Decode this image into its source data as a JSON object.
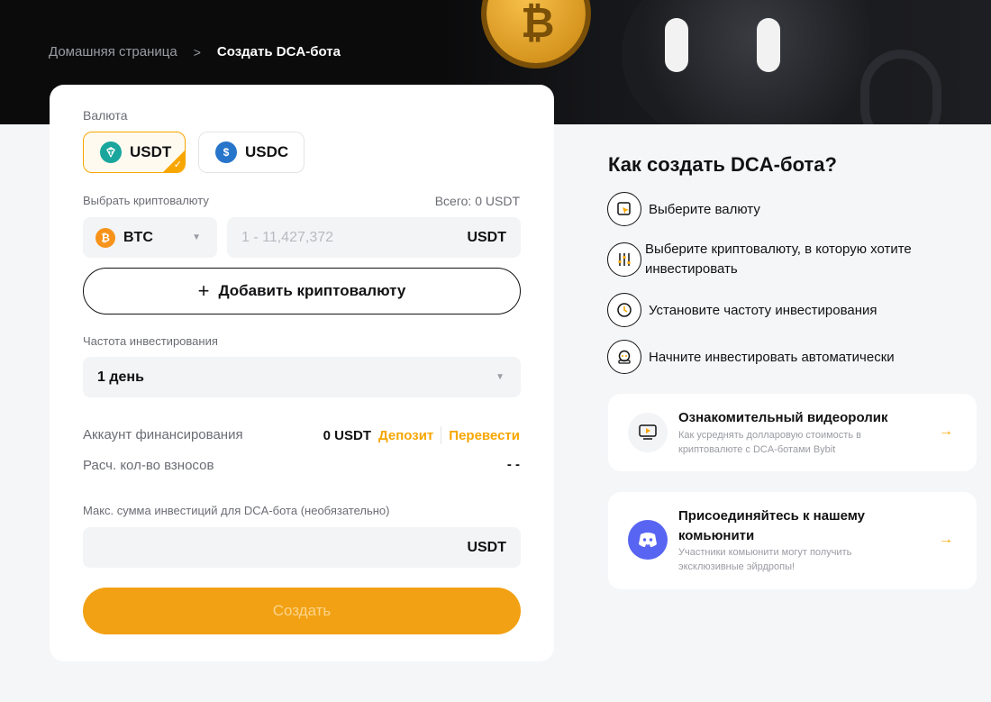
{
  "breadcrumb": {
    "home": "Домашняя страница",
    "separator": ">",
    "current": "Создать DCA-бота"
  },
  "form": {
    "currency_label": "Валюта",
    "currencies": [
      {
        "label": "USDT",
        "icon": "tether-icon",
        "color": "#1aa69c",
        "selected": true
      },
      {
        "label": "USDC",
        "icon": "usdc-icon",
        "color": "#2775ca",
        "selected": false
      }
    ],
    "crypto_label": "Выбрать криптовалюту",
    "total": "Всего: 0 USDT",
    "crypto_select": {
      "value": "BTC",
      "icon": "bitcoin-icon",
      "icon_color": "#f7931a",
      "glyph": "₿"
    },
    "amount_placeholder": "1 - 11,427,372",
    "amount_unit": "USDT",
    "add_crypto": "Добавить криптовалюту",
    "frequency_label": "Частота инвестирования",
    "frequency_value": "1 день",
    "funding_label": "Аккаунт финансирования",
    "funding_value": "0 USDT",
    "deposit": "Депозит",
    "transfer": "Перевести",
    "installments_label": "Расч. кол-во взносов",
    "installments_value": "- -",
    "max_label": "Макс. сумма инвестиций для DCA-бота (необязательно)",
    "max_unit": "USDT",
    "create": "Создать"
  },
  "guide": {
    "title": "Как создать DCA-бота?",
    "steps": [
      {
        "text": "Выберите валюту",
        "icon": "cursor-select-icon"
      },
      {
        "text": "Выберите криптовалюту, в которую хотите инвестировать",
        "icon": "sliders-icon"
      },
      {
        "text": "Установите частоту инвестирования",
        "icon": "clock-icon"
      },
      {
        "text": "Начните инвестировать автоматически",
        "icon": "robot-icon"
      }
    ]
  },
  "promos": [
    {
      "title": "Ознакомительный видеоролик",
      "subtitle": "Как усреднять долларовую стоимость в криптовалюте с DCA-ботами Bybit",
      "icon": "video-play-icon"
    },
    {
      "title": "Присоединяйтесь к нашему комьюнити",
      "subtitle": "Участники комьюнити могут получить эксклюзивные эйрдропы!",
      "icon": "discord-icon",
      "color": "#5865f2"
    }
  ],
  "colors": {
    "accent": "#f7a600",
    "button": "#f2a114",
    "hero_bg": "#0b0b0c",
    "page_bg": "#f5f6f8"
  }
}
